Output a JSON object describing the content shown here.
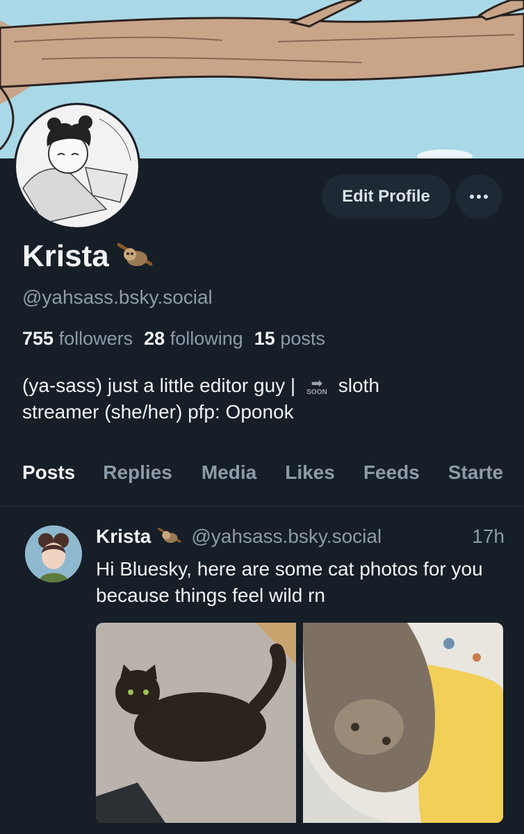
{
  "profile": {
    "name": "Krista",
    "name_emoji": "sloth",
    "handle": "@yahsass.bsky.social",
    "edit_label": "Edit Profile",
    "stats": [
      {
        "value": "755",
        "label": "followers"
      },
      {
        "value": "28",
        "label": "following"
      },
      {
        "value": "15",
        "label": "posts"
      }
    ],
    "bio_line1_pre": "(ya-sass) just a little editor guy |",
    "bio_soon": "SOON",
    "bio_line1_post": "sloth",
    "bio_line2": "streamer (she/her) pfp: Oponok"
  },
  "tabs": [
    {
      "label": "Posts",
      "active": true
    },
    {
      "label": "Replies"
    },
    {
      "label": "Media"
    },
    {
      "label": "Likes"
    },
    {
      "label": "Feeds"
    },
    {
      "label": "Starte"
    }
  ],
  "post": {
    "author": "Krista",
    "handle": "@yahsass.bsky.social",
    "time": "17h",
    "text": "Hi Bluesky, here are some cat photos for you because things feel wild rn"
  },
  "colors": {
    "background": "#161e27",
    "accent": "#1d84f0",
    "muted": "#8d9ba8",
    "button_bg": "#1e2935"
  }
}
